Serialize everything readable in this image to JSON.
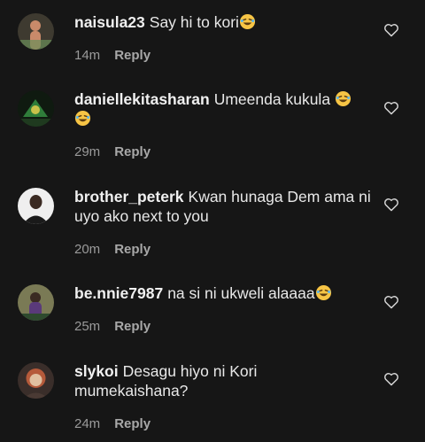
{
  "comments": [
    {
      "username": "naisula23",
      "text": "Say hi to kori",
      "emoji_count": 1,
      "time": "14m",
      "reply_label": "Reply",
      "avatar_colors": [
        "#3e3a30",
        "#c98a6a",
        "#6b8f5a"
      ]
    },
    {
      "username": "daniellekitasharan",
      "text": "Umeenda kukula ",
      "emoji_count": 2,
      "time": "29m",
      "reply_label": "Reply",
      "avatar_colors": [
        "#0f1a10",
        "#2f7d3a",
        "#c9c24a"
      ]
    },
    {
      "username": "brother_peterk",
      "text": "Kwan hunaga Dem ama ni uyo ako next to you",
      "emoji_count": 0,
      "time": "20m",
      "reply_label": "Reply",
      "avatar_colors": [
        "#efefef",
        "#3a2a22",
        "#1a1a1a"
      ]
    },
    {
      "username": "be.nnie7987",
      "text": "na si ni ukweli alaaaa",
      "emoji_count": 1,
      "time": "25m",
      "reply_label": "Reply",
      "avatar_colors": [
        "#7a7a55",
        "#5a3a7a",
        "#2e4a2e"
      ]
    },
    {
      "username": "slykoi",
      "text": "Desagu hiyo ni Kori mumekaishana?",
      "emoji_count": 0,
      "time": "24m",
      "reply_label": "Reply",
      "avatar_colors": [
        "#3a2e2a",
        "#b55a3a",
        "#e0c0a0"
      ]
    }
  ],
  "icons": {
    "like": "heart-outline-icon",
    "emoji": "laughing-emoji-icon"
  },
  "colors": {
    "background": "#161616",
    "text": "#e8e8e8",
    "meta": "#9a9a9a",
    "emoji_face": "#f6c445"
  }
}
